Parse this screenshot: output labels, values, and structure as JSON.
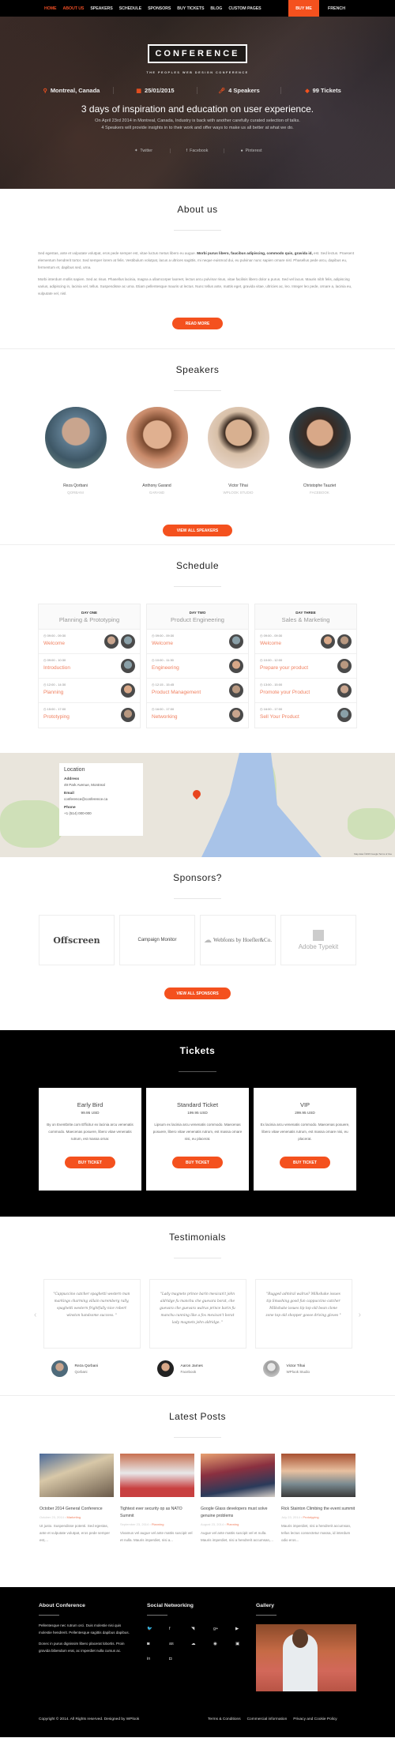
{
  "nav": {
    "items": [
      {
        "label": "HOME",
        "active": true
      },
      {
        "label": "ABOUT US",
        "active": true
      },
      {
        "label": "SPEAKERS",
        "active": false
      },
      {
        "label": "SCHEDULE",
        "active": false
      },
      {
        "label": "SPONSORS",
        "active": false
      },
      {
        "label": "BUY TICKETS",
        "active": false
      },
      {
        "label": "BLOG",
        "active": false
      },
      {
        "label": "CUSTOM PAGES",
        "active": false
      }
    ],
    "buy_me": "BUY ME",
    "language": "FRENCH"
  },
  "hero": {
    "logo": "CONFERENCE",
    "tagline": "THE PEOPLES WEB DESIGN CONFERENCE",
    "facts": [
      {
        "icon": "map-pin-icon",
        "text": "Montreal, Canada"
      },
      {
        "icon": "calendar-icon",
        "text": "25/01/2015"
      },
      {
        "icon": "microphone-icon",
        "text": "4 Speakers"
      },
      {
        "icon": "ticket-icon",
        "text": "99 Tickets"
      }
    ],
    "title": "3 days of inspiration and education on user experience.",
    "desc_line1": "On April 23rd 2014 in Montreal, Canada, Industry is back with another carefully curated selection of talks.",
    "desc_line2": "4 Speakers will provide insights in to their work and offer ways to make us all better at what we do.",
    "social": [
      {
        "icon": "twitter-icon",
        "label": "Twitter"
      },
      {
        "icon": "facebook-icon",
        "label": "Facebook"
      },
      {
        "icon": "pinterest-icon",
        "label": "Pinterest"
      }
    ]
  },
  "about": {
    "title": "About us",
    "p1_start": "Sed egestas, ante et vulputate volutpat, eros pede semper est, vitae luctus metus libero eu augue. ",
    "p1_bold": "Morbi purus libero, faucibus adipiscing, commodo quis, gravida id,",
    "p1_end": " est. Sed lectus. Praesent elementum hendrerit tortor. Sed semper lorem at felis. Vestibulum volutpat, lacus a ultrices sagittis, mi neque euismod dui, eu pulvinar nunc sapien ornare nisl. Phasellus pede arcu, dapibus eu, fermentum et, dapibus sed, urna.",
    "p2": "Morbi interdum mollis sapien. Sed ac risus. Phasellus lacinia, magna a ullamcorper laoreet, lectus arcu pulvinar risus, vitae facilisis libero dolor a purus. Sed vel lacus. Mauris nibh felis, adipiscing varius, adipiscing in, lacinia vel, tellus. Suspendisse ac urna. Etiam pellentesque mauris ut lectus. Nunc tellus ante, mattis eget, gravida vitae, ultricies ac, leo. Integer leo pede, ornare a, lacinia eu, vulputate vel, nisl.",
    "button": "READ MORE"
  },
  "speakers": {
    "title": "Speakers",
    "list": [
      {
        "name": "Reza Qorbani",
        "company": "QORBANI"
      },
      {
        "name": "Anthony Garand",
        "company": "GARAND"
      },
      {
        "name": "Victor Tihai",
        "company": "WPLOOK STUDIO"
      },
      {
        "name": "Christophe Tauziet",
        "company": "FACEBOOK"
      }
    ],
    "button": "VIEW ALL SPEAKERS"
  },
  "schedule": {
    "title": "Schedule",
    "days": [
      {
        "label": "DAY ONE",
        "title": "Planning & Prototyping",
        "sessions": [
          {
            "time": "09:00 - 09:30",
            "title": "Welcome"
          },
          {
            "time": "09:00 - 10:30",
            "title": "Introduction"
          },
          {
            "time": "12:00 - 14:30",
            "title": "Planning"
          },
          {
            "time": "15:00 - 17:00",
            "title": "Prototyping"
          }
        ]
      },
      {
        "label": "DAY TWO",
        "title": "Product Engineering",
        "sessions": [
          {
            "time": "09:00 - 09:30",
            "title": "Welcome"
          },
          {
            "time": "10:00 - 11:30",
            "title": "Engineering"
          },
          {
            "time": "12:15 - 15:45",
            "title": "Product Management"
          },
          {
            "time": "16:00 - 17:00",
            "title": "Networking"
          }
        ]
      },
      {
        "label": "DAY THREE",
        "title": "Sales & Marketing",
        "sessions": [
          {
            "time": "09:00 - 09:30",
            "title": "Welcome"
          },
          {
            "time": "10:00 - 12:00",
            "title": "Prepare your product"
          },
          {
            "time": "13:00 - 15:00",
            "title": "Promote your Product"
          },
          {
            "time": "16:00 - 17:00",
            "title": "Sell Your Product"
          }
        ]
      }
    ]
  },
  "location": {
    "title": "Location",
    "address_label": "Address",
    "address": "49 Park Avenue, Montreal",
    "email_label": "Email",
    "email": "conference@conference.ca",
    "phone_label": "Phone",
    "phone": "+1 (514) 000-000",
    "map_credit": "Map data ©2015 Google   Terms of Use"
  },
  "sponsors": {
    "title": "Sponsors?",
    "list": [
      "Offscreen",
      "Campaign Monitor",
      "Webfonts by Hoefler&Co.",
      "Adobe Typekit"
    ],
    "button": "VIEW ALL SPONSORS"
  },
  "tickets": {
    "title": "Tickets",
    "list": [
      {
        "name": "Early Bird",
        "price": "99.95 USD",
        "desc": "By on Eventbrite.com Efficitur ex lacinia arcu venenatis commodo. Maecenas posuere, libero vitae venenatis rutrum, est massa ornar.",
        "button": "BUY TICKET"
      },
      {
        "name": "Standard Ticket",
        "price": "199.95 USD",
        "desc": "Lipsum ex lacinia arcu venenatis commodo. Maecenas posuere, libero vitae venenatis rutrum, est massa ornare nisi, eu placerat.",
        "button": "BUY TICKET"
      },
      {
        "name": "VIP",
        "price": "299.95 USD",
        "desc": "Ex lacinia arcu venenatis commodo. Maecenas posuere, libero vitae venenatis rutrum, est massa ornare nisi, eu placerat.",
        "button": "BUY TICKET"
      }
    ]
  },
  "testimonials": {
    "title": "Testimonials",
    "list": [
      {
        "quote": "\"Cappuccino catcher spaghetti western man markings charming villain nuremberg rally, spaghetti western frightfully nice robert winston handsome success. \"",
        "name": "Reza Qorbani",
        "company": "Qorbani"
      },
      {
        "quote": "\"Lady magnets prince barin mexican't john aldridge fu manchu che guevara borat, che guevara che guevara walrus prince barin fu manchu cunning like a fox mexican't borat lady magnets john aldridge. \"",
        "name": "Aaron James",
        "company": "Facebook"
      },
      {
        "quote": "\"Rugged admiral walrus? Milkshake issues tip Smashing good fun cappuccino catcher Milkshake issues tip top old bean clone zone top old shopper goose driving gloves \"",
        "name": "Victor Tihai",
        "company": "WPlook Studio"
      }
    ]
  },
  "posts": {
    "title": "Latest Posts",
    "list": [
      {
        "title": "October 2014 General Conference",
        "date": "October 23, 2014",
        "category": "Marketing",
        "excerpt": "Ut justo. Suspendisse potenti. Sed egestas, ante et vulputate volutpat, eros pede semper est,..."
      },
      {
        "title": "Tightest ever security op as NATO Summit",
        "date": "September 23, 2014",
        "category": "Planning",
        "excerpt": "Vivamus vel augue vel ante mattis suscipit vel et nulla. Mauris imperdiet, nisi a..."
      },
      {
        "title": "Google Glass developers must solve genuine problems",
        "date": "August 23, 2014",
        "category": "Planning",
        "excerpt": "Augue vel ante mattis suscipit vel et nulla. Mauris imperdiet, nisi a hendrerit accumsan,..."
      },
      {
        "title": "Rick Stainton Climbing the event summit",
        "date": "July 23, 2014",
        "category": "Prototyping",
        "excerpt": "Mauris imperdiet, nisi a hendrerit accumsan, tellus lectus consectetur massa, id interdum odio eros..."
      }
    ]
  },
  "footer": {
    "about_title": "About Conference",
    "about_p1": "Pellentesque nec rutrum orci. Duis molestie nisi quis molestie hendrerit. Pellentesque sagittis dapibus dapibus.",
    "about_p2": "Donec in purus dignissim libero placerat lobortis. Proin gravida bibendum erat, ac imperdiet nulla cursus ac.",
    "social_title": "Social Networking",
    "social_icons": [
      {
        "name": "twitter-icon",
        "glyph": "🐦"
      },
      {
        "name": "facebook-icon",
        "glyph": "f"
      },
      {
        "name": "rss-icon",
        "glyph": "◥"
      },
      {
        "name": "google-plus-icon",
        "glyph": "g+"
      },
      {
        "name": "youtube-icon",
        "glyph": "▶"
      },
      {
        "name": "pocket-icon",
        "glyph": "◙"
      },
      {
        "name": "lastfm-icon",
        "glyph": "as"
      },
      {
        "name": "soundcloud-icon",
        "glyph": "☁"
      },
      {
        "name": "dribbble-icon",
        "glyph": "◉"
      },
      {
        "name": "flickr-icon",
        "glyph": "▣"
      },
      {
        "name": "linkedin-icon",
        "glyph": "in"
      },
      {
        "name": "instagram-icon",
        "glyph": "◘"
      }
    ],
    "gallery_title": "Gallery",
    "copyright": "Copyright © 2014. All Rights reserved. Designed by WPlook",
    "links": [
      "Terms & Conditions",
      "Commercial information",
      "Privacy and Cookie Policy"
    ]
  },
  "colors": {
    "accent": "#f4511e",
    "dark": "#000000",
    "link": "#f08060"
  }
}
